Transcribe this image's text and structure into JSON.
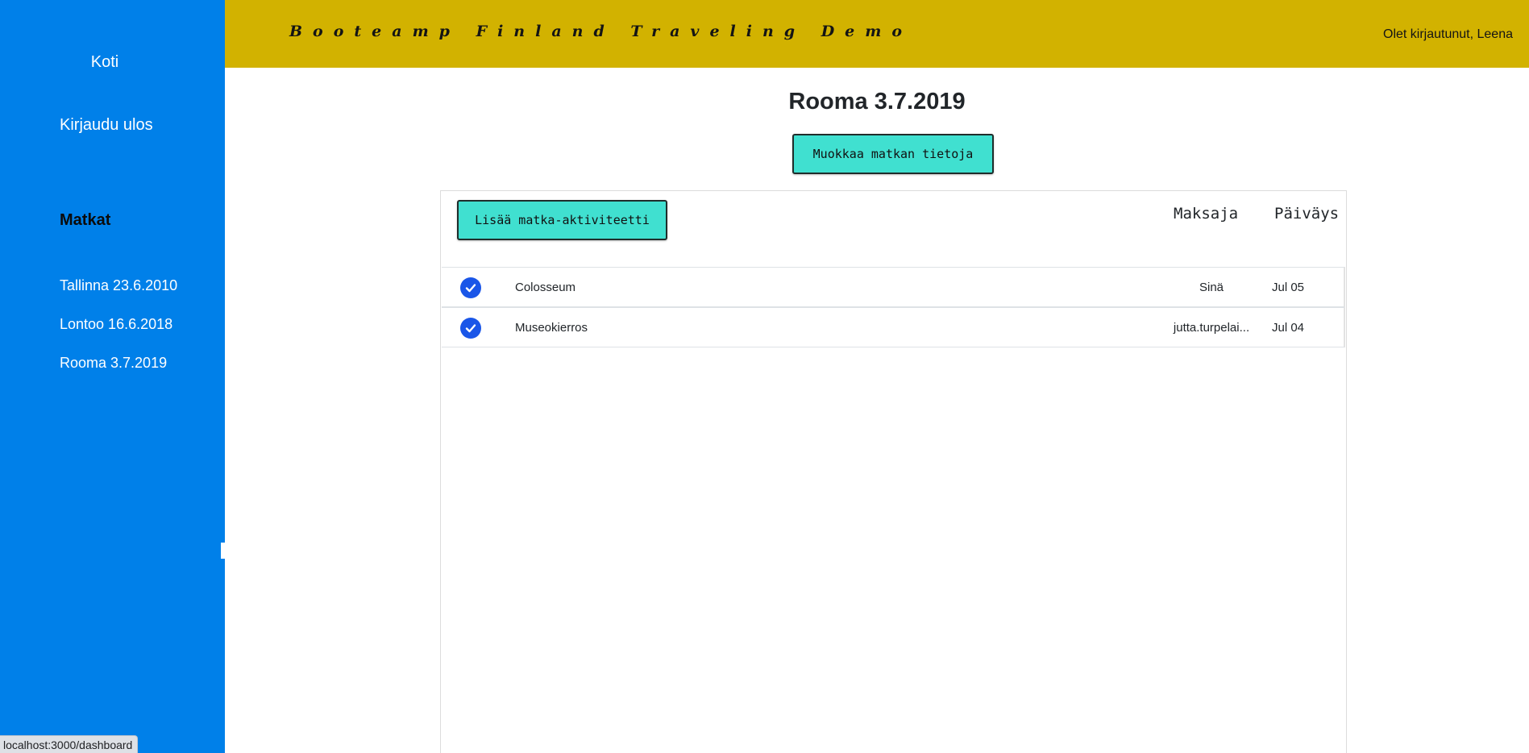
{
  "sidebar": {
    "home_label": "Koti",
    "logout_label": "Kirjaudu ulos",
    "trips_heading": "Matkat",
    "trips": [
      {
        "label": "Tallinna 23.6.2010"
      },
      {
        "label": "Lontoo 16.6.2018"
      },
      {
        "label": "Rooma 3.7.2019"
      }
    ]
  },
  "header": {
    "brand": "Booteamp Finland Traveling Demo",
    "user_status": "Olet kirjautunut, Leena"
  },
  "main": {
    "title": "Rooma 3.7.2019",
    "edit_trip_label": "Muokkaa matkan tietoja",
    "add_activity_label": "Lisää matka-aktiviteetti",
    "columns": {
      "payer": "Maksaja",
      "date": "Päiväys"
    },
    "activities": [
      {
        "icon": "check-circle-icon",
        "done": true,
        "name": "Colosseum",
        "payer": "Sinä",
        "date": "Jul 05"
      },
      {
        "icon": "check-circle-icon",
        "done": true,
        "name": "Museokierros",
        "payer": "jutta.turpelai...",
        "date": "Jul 04"
      }
    ]
  },
  "status_bar": {
    "url": "localhost:3000/dashboard"
  },
  "colors": {
    "sidebar_bg": "#0080e9",
    "header_bg": "#d2b200",
    "button_bg": "#40e0d0",
    "check_icon": "#1a56e8"
  }
}
